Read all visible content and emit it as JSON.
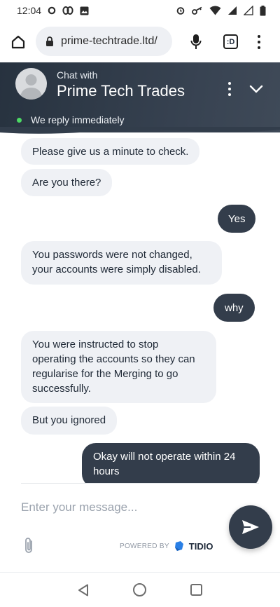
{
  "status_bar": {
    "time": "12:04",
    "icons": [
      "sync-icon",
      "link-icon",
      "image-icon",
      "alarm-icon",
      "key-icon",
      "wifi-icon",
      "signal-icon",
      "signal-roaming-icon",
      "battery-icon"
    ]
  },
  "browser": {
    "url": "prime-techtrade.ltd/",
    "tab_count": ":D",
    "icons": [
      "home-icon",
      "lock-icon",
      "mic-icon",
      "tabs-icon",
      "more-vertical-icon"
    ]
  },
  "chat_header": {
    "subtitle": "Chat with",
    "title": "Prime Tech Trades",
    "status": "We reply immediately",
    "colors": {
      "header_bg": "#2f3a48",
      "online": "#4cd964"
    }
  },
  "messages": [
    {
      "from": "agent",
      "text": "Please give us a minute to check."
    },
    {
      "from": "agent",
      "text": "Are you there?"
    },
    {
      "from": "user",
      "text": "Yes"
    },
    {
      "from": "agent",
      "text": "You passwords were not changed, your accounts were simply disabled."
    },
    {
      "from": "user",
      "text": "why"
    },
    {
      "from": "agent",
      "text": "You were instructed to stop operating the accounts so they can regularise for the Merging to go successfully."
    },
    {
      "from": "agent",
      "text": "But you ignored"
    },
    {
      "from": "user",
      "text": "Okay will not operate within 24 hours"
    }
  ],
  "composer": {
    "placeholder": "Enter your message...",
    "powered_by": "POWERED BY",
    "brand": "TIDIO",
    "colors": {
      "send_bg": "#333d4b",
      "brand_blue": "#2a7fe5"
    }
  },
  "nav_bar": {
    "icons": [
      "back-icon",
      "home-circle-icon",
      "recents-icon"
    ]
  }
}
